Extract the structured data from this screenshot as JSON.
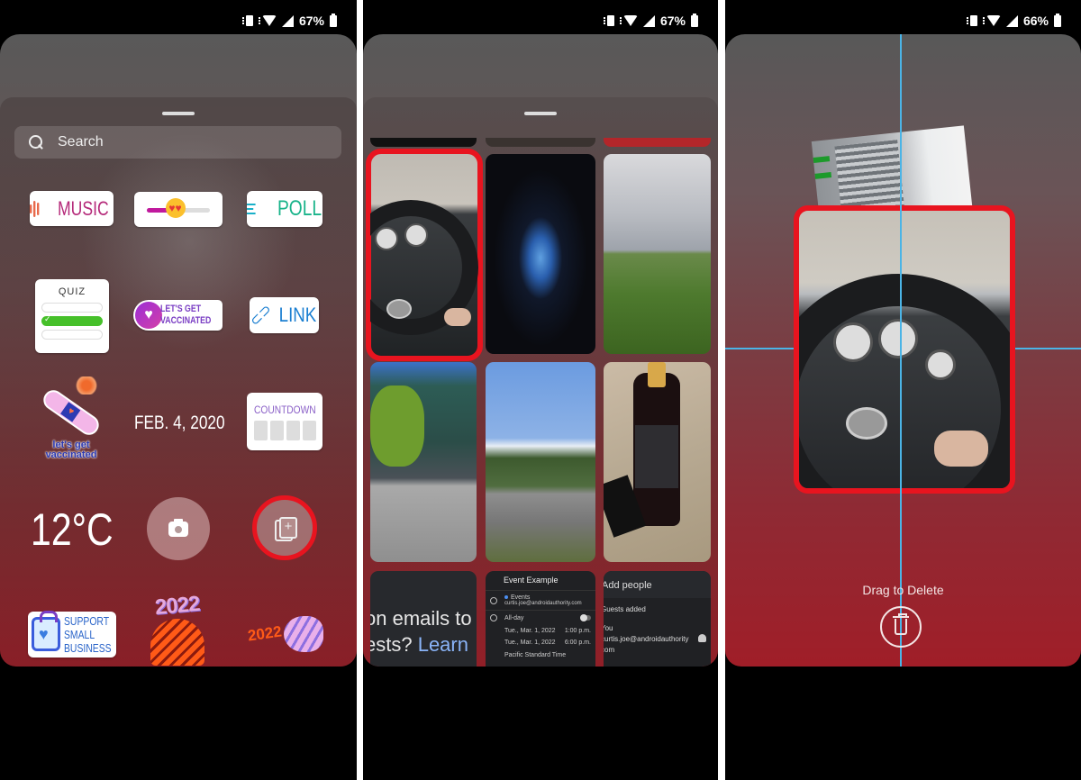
{
  "panels": [
    {
      "status_bar": {
        "battery": "67%"
      },
      "search": {
        "placeholder": "Search"
      },
      "stickers": {
        "music": "MUSIC",
        "slider_emoji": "heart-eyes",
        "slider_value": 0.45,
        "poll": "POLL",
        "quiz": "QUIZ",
        "vaccinated_line1": "LET'S GET",
        "vaccinated_line2": "VACCINATED",
        "link": "LINK",
        "bandaid_line1": "let's get",
        "bandaid_line2": "vaccinated",
        "date": "FEB. 4, 2020",
        "countdown": "COUNTDOWN",
        "temperature": "12°C",
        "support_line1": "SUPPORT",
        "support_line2": "SMALL",
        "support_line3": "BUSINESS",
        "tiger_year_1": "2022",
        "tiger_year_2": "2022"
      },
      "buttons": {
        "camera": "camera-icon",
        "gallery": "add-from-gallery-icon"
      },
      "highlight_color": "#e8141f"
    },
    {
      "status_bar": {
        "battery": "67%"
      },
      "photos": [
        {
          "subject": "car steering wheel",
          "selected": true
        },
        {
          "subject": "night concert stage"
        },
        {
          "subject": "cloudy field"
        },
        {
          "subject": "building street"
        },
        {
          "subject": "mountains road"
        },
        {
          "subject": "wine bottle"
        }
      ],
      "screenshot_emails": {
        "line1": "on emails to",
        "line2_prefix": "ests? ",
        "line2_link": "Learn"
      },
      "screenshot_event": {
        "title": "Event Example",
        "calendar": "Events",
        "account": "curtis.joe@androidauthority.com",
        "all_day": "All-day",
        "start_date": "Tue., Mar. 1, 2022",
        "start_time": "1:00 p.m.",
        "end_date": "Tue., Mar. 1, 2022",
        "end_time": "6:00 p.m.",
        "timezone": "Pacific Standard Time"
      },
      "screenshot_people": {
        "title": "Add people",
        "guests": "Guests added",
        "you": "You",
        "email": "curtis.joe@androidauthority",
        "email_tail": "com"
      }
    },
    {
      "status_bar": {
        "battery": "66%"
      },
      "drag_label": "Drag to Delete",
      "guide_color": "#4bb4e6"
    }
  ]
}
